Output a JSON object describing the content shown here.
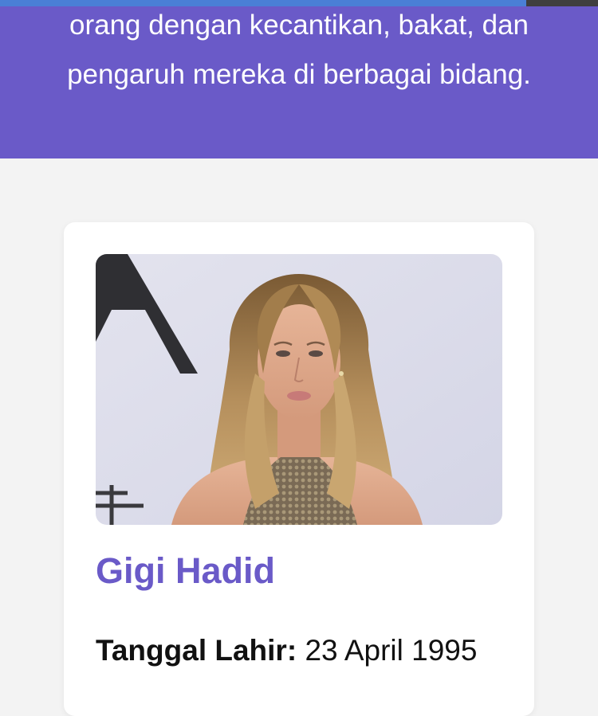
{
  "page": {
    "progress": 0.88,
    "colors": {
      "accent": "#6a5ac8",
      "background": "#f3f3f3",
      "card": "#ffffff",
      "progress_fill": "#4a7fd6",
      "progress_track": "#3f3f3f"
    }
  },
  "hero": {
    "text": "orang dengan kecantikan, bakat, dan pengaruh mereka di berbagai bidang."
  },
  "profile": {
    "photo_icon": "portrait-photo",
    "name": "Gigi Hadid",
    "birth_label": "Tanggal Lahir:",
    "birth_value": "23 April 1995"
  }
}
